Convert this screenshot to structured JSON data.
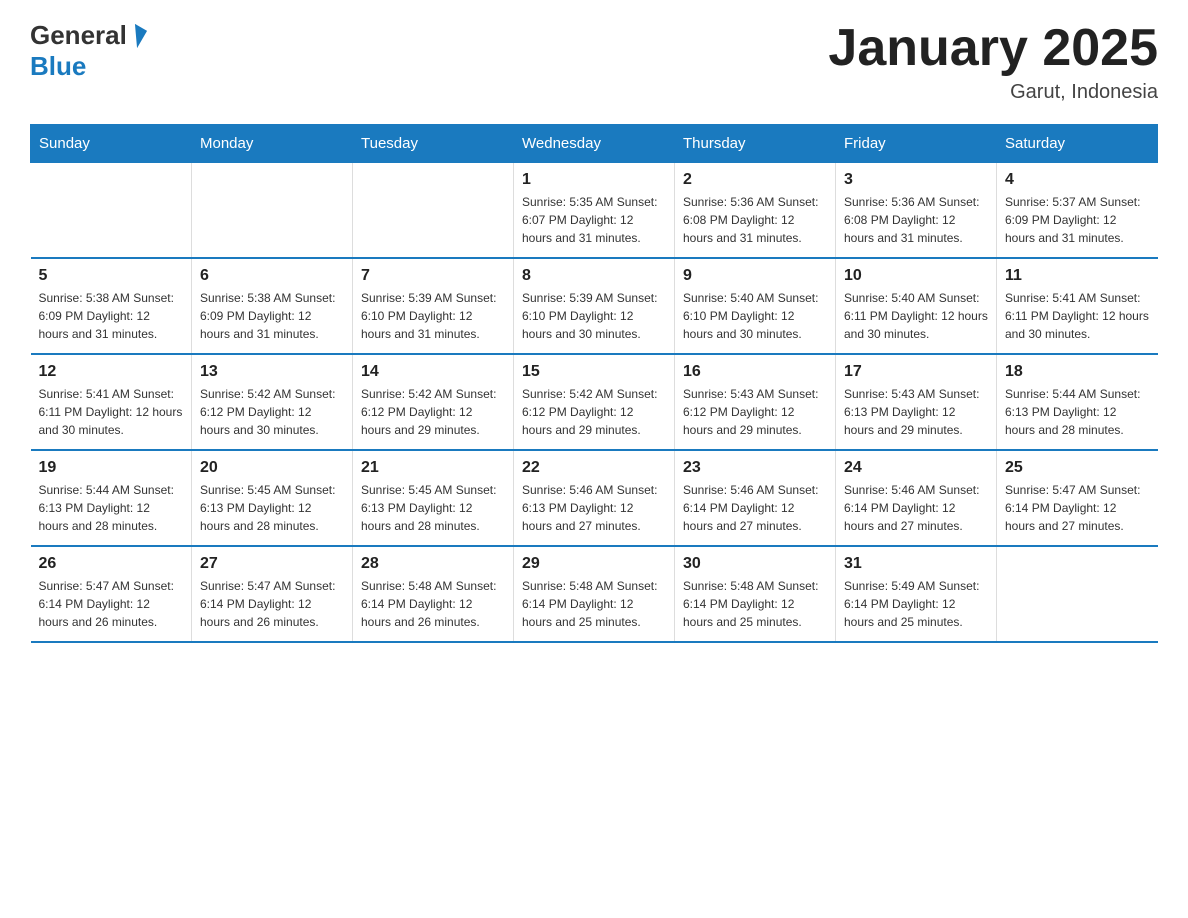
{
  "logo": {
    "general": "General",
    "blue": "Blue"
  },
  "title": "January 2025",
  "subtitle": "Garut, Indonesia",
  "days_header": [
    "Sunday",
    "Monday",
    "Tuesday",
    "Wednesday",
    "Thursday",
    "Friday",
    "Saturday"
  ],
  "weeks": [
    [
      {
        "day": "",
        "info": ""
      },
      {
        "day": "",
        "info": ""
      },
      {
        "day": "",
        "info": ""
      },
      {
        "day": "1",
        "info": "Sunrise: 5:35 AM\nSunset: 6:07 PM\nDaylight: 12 hours\nand 31 minutes."
      },
      {
        "day": "2",
        "info": "Sunrise: 5:36 AM\nSunset: 6:08 PM\nDaylight: 12 hours\nand 31 minutes."
      },
      {
        "day": "3",
        "info": "Sunrise: 5:36 AM\nSunset: 6:08 PM\nDaylight: 12 hours\nand 31 minutes."
      },
      {
        "day": "4",
        "info": "Sunrise: 5:37 AM\nSunset: 6:09 PM\nDaylight: 12 hours\nand 31 minutes."
      }
    ],
    [
      {
        "day": "5",
        "info": "Sunrise: 5:38 AM\nSunset: 6:09 PM\nDaylight: 12 hours\nand 31 minutes."
      },
      {
        "day": "6",
        "info": "Sunrise: 5:38 AM\nSunset: 6:09 PM\nDaylight: 12 hours\nand 31 minutes."
      },
      {
        "day": "7",
        "info": "Sunrise: 5:39 AM\nSunset: 6:10 PM\nDaylight: 12 hours\nand 31 minutes."
      },
      {
        "day": "8",
        "info": "Sunrise: 5:39 AM\nSunset: 6:10 PM\nDaylight: 12 hours\nand 30 minutes."
      },
      {
        "day": "9",
        "info": "Sunrise: 5:40 AM\nSunset: 6:10 PM\nDaylight: 12 hours\nand 30 minutes."
      },
      {
        "day": "10",
        "info": "Sunrise: 5:40 AM\nSunset: 6:11 PM\nDaylight: 12 hours\nand 30 minutes."
      },
      {
        "day": "11",
        "info": "Sunrise: 5:41 AM\nSunset: 6:11 PM\nDaylight: 12 hours\nand 30 minutes."
      }
    ],
    [
      {
        "day": "12",
        "info": "Sunrise: 5:41 AM\nSunset: 6:11 PM\nDaylight: 12 hours\nand 30 minutes."
      },
      {
        "day": "13",
        "info": "Sunrise: 5:42 AM\nSunset: 6:12 PM\nDaylight: 12 hours\nand 30 minutes."
      },
      {
        "day": "14",
        "info": "Sunrise: 5:42 AM\nSunset: 6:12 PM\nDaylight: 12 hours\nand 29 minutes."
      },
      {
        "day": "15",
        "info": "Sunrise: 5:42 AM\nSunset: 6:12 PM\nDaylight: 12 hours\nand 29 minutes."
      },
      {
        "day": "16",
        "info": "Sunrise: 5:43 AM\nSunset: 6:12 PM\nDaylight: 12 hours\nand 29 minutes."
      },
      {
        "day": "17",
        "info": "Sunrise: 5:43 AM\nSunset: 6:13 PM\nDaylight: 12 hours\nand 29 minutes."
      },
      {
        "day": "18",
        "info": "Sunrise: 5:44 AM\nSunset: 6:13 PM\nDaylight: 12 hours\nand 28 minutes."
      }
    ],
    [
      {
        "day": "19",
        "info": "Sunrise: 5:44 AM\nSunset: 6:13 PM\nDaylight: 12 hours\nand 28 minutes."
      },
      {
        "day": "20",
        "info": "Sunrise: 5:45 AM\nSunset: 6:13 PM\nDaylight: 12 hours\nand 28 minutes."
      },
      {
        "day": "21",
        "info": "Sunrise: 5:45 AM\nSunset: 6:13 PM\nDaylight: 12 hours\nand 28 minutes."
      },
      {
        "day": "22",
        "info": "Sunrise: 5:46 AM\nSunset: 6:13 PM\nDaylight: 12 hours\nand 27 minutes."
      },
      {
        "day": "23",
        "info": "Sunrise: 5:46 AM\nSunset: 6:14 PM\nDaylight: 12 hours\nand 27 minutes."
      },
      {
        "day": "24",
        "info": "Sunrise: 5:46 AM\nSunset: 6:14 PM\nDaylight: 12 hours\nand 27 minutes."
      },
      {
        "day": "25",
        "info": "Sunrise: 5:47 AM\nSunset: 6:14 PM\nDaylight: 12 hours\nand 27 minutes."
      }
    ],
    [
      {
        "day": "26",
        "info": "Sunrise: 5:47 AM\nSunset: 6:14 PM\nDaylight: 12 hours\nand 26 minutes."
      },
      {
        "day": "27",
        "info": "Sunrise: 5:47 AM\nSunset: 6:14 PM\nDaylight: 12 hours\nand 26 minutes."
      },
      {
        "day": "28",
        "info": "Sunrise: 5:48 AM\nSunset: 6:14 PM\nDaylight: 12 hours\nand 26 minutes."
      },
      {
        "day": "29",
        "info": "Sunrise: 5:48 AM\nSunset: 6:14 PM\nDaylight: 12 hours\nand 25 minutes."
      },
      {
        "day": "30",
        "info": "Sunrise: 5:48 AM\nSunset: 6:14 PM\nDaylight: 12 hours\nand 25 minutes."
      },
      {
        "day": "31",
        "info": "Sunrise: 5:49 AM\nSunset: 6:14 PM\nDaylight: 12 hours\nand 25 minutes."
      },
      {
        "day": "",
        "info": ""
      }
    ]
  ]
}
